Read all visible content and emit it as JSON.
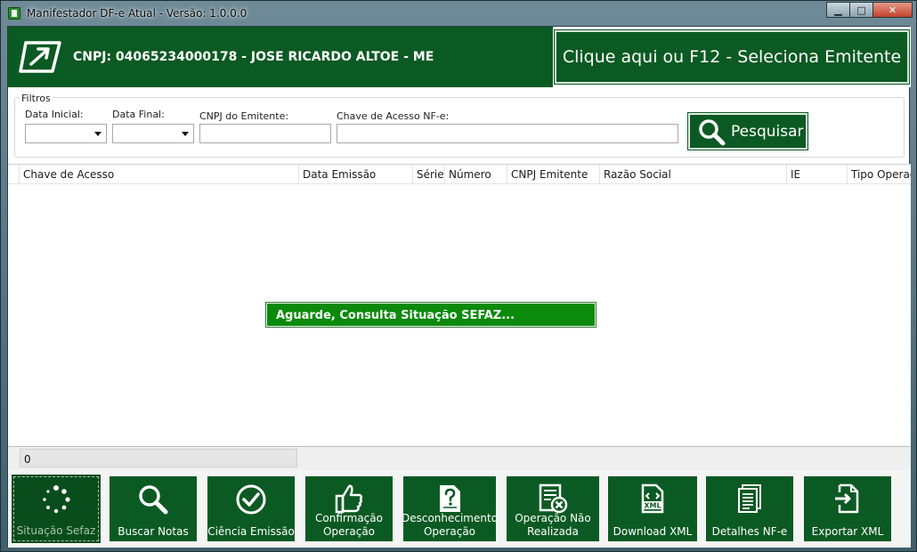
{
  "window": {
    "title": "Manifestador DF-e Atual - Versão: 1.0.0.0",
    "minimize": "▁",
    "maximize": "□",
    "close": "✕"
  },
  "header": {
    "company": "CNPJ: 04065234000178 - JOSE RICARDO ALTOE - ME",
    "select_emitente": "Clique aqui ou F12 - Seleciona Emitente"
  },
  "filters": {
    "legend": "Filtros",
    "data_inicial_label": "Data Inicial:",
    "data_final_label": "Data Final:",
    "cnpj_label": "CNPJ do Emitente:",
    "chave_label": "Chave de Acesso NF-e:",
    "cnpj_value": "",
    "chave_value": "",
    "search_label": "Pesquisar"
  },
  "grid": {
    "columns": [
      "Chave de Acesso",
      "Data Emissão",
      "Série",
      "Número",
      "CNPJ Emitente",
      "Razão Social",
      "IE",
      "Tipo Operação"
    ],
    "rows": []
  },
  "overlay": {
    "message": "Aguarde, Consulta Situação SEFAZ..."
  },
  "status": {
    "count": "0"
  },
  "toolbar": {
    "buttons": [
      {
        "label": "Situação Sefaz",
        "icon": "loading-spinner-icon"
      },
      {
        "label": "Buscar Notas",
        "icon": "search-icon"
      },
      {
        "label": "Ciência Emissão",
        "icon": "check-circle-icon"
      },
      {
        "label_line1": "Confirmação",
        "label_line2": "Operação",
        "icon": "thumbs-up-icon"
      },
      {
        "label_line1": "Desconhecimento",
        "label_line2": "Operação",
        "icon": "question-document-icon"
      },
      {
        "label_line1": "Operação Não",
        "label_line2": "Realizada",
        "icon": "rejected-document-icon"
      },
      {
        "label": "Download XML",
        "icon": "xml-file-icon"
      },
      {
        "label": "Detalhes NF-e",
        "icon": "document-list-icon"
      },
      {
        "label": "Exportar XML",
        "icon": "export-file-icon"
      }
    ]
  },
  "colors": {
    "brand_green": "#0c5a23",
    "message_green": "#0b8a0b"
  }
}
